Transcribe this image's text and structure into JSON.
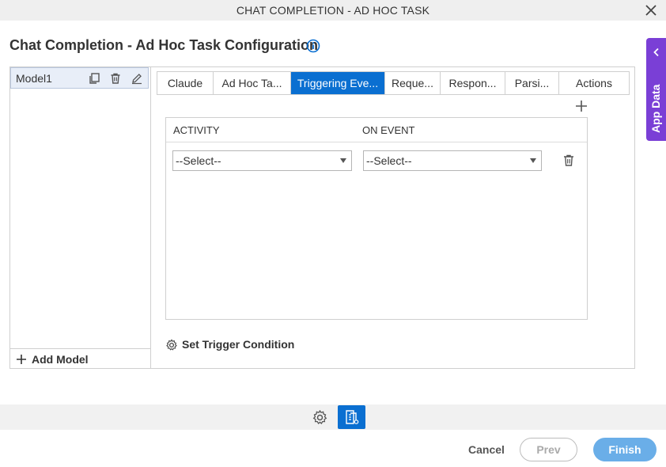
{
  "window": {
    "title": "CHAT COMPLETION - AD HOC TASK"
  },
  "page": {
    "heading": "Chat Completion - Ad Hoc Task Configuration"
  },
  "models": {
    "items": [
      {
        "label": "Model1"
      }
    ],
    "add_label": "Add Model"
  },
  "tabs": [
    {
      "label": "Claude",
      "active": false
    },
    {
      "label": "Ad Hoc Ta...",
      "active": false
    },
    {
      "label": "Triggering Eve...",
      "active": true
    },
    {
      "label": "Reque...",
      "active": false
    },
    {
      "label": "Respon...",
      "active": false
    },
    {
      "label": "Parsi...",
      "active": false
    },
    {
      "label": "Actions",
      "active": false
    }
  ],
  "grid": {
    "columns": [
      "ACTIVITY",
      "ON EVENT"
    ],
    "rows": [
      {
        "activity": "--Select--",
        "on_event": "--Select--"
      }
    ]
  },
  "trigger": {
    "label": "Set Trigger Condition"
  },
  "side_panel": {
    "label": "App Data"
  },
  "footer": {
    "cancel": "Cancel",
    "prev": "Prev",
    "finish": "Finish"
  },
  "colors": {
    "accent": "#0a6fd1",
    "app_data": "#7a3fd6",
    "finish_disabled": "#6aaee8"
  }
}
